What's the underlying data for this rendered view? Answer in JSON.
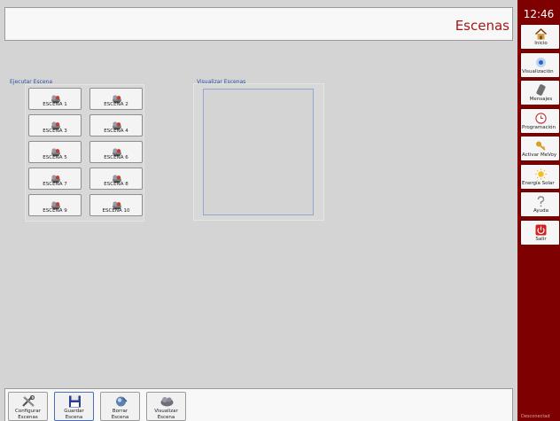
{
  "header": {
    "title": "Escenas"
  },
  "clock": "12:46",
  "ejecutar": {
    "title": "Ejecutar Escena",
    "scenes": [
      "ESCENA 1",
      "ESCENA 2",
      "ESCENA 3",
      "ESCENA 4",
      "ESCENA 5",
      "ESCENA 6",
      "ESCENA 7",
      "ESCENA 8",
      "ESCENA 9",
      "ESCENA 10"
    ]
  },
  "visualizar": {
    "title": "Visualizar Escenas"
  },
  "toolbar": {
    "items": [
      {
        "line1": "Configurar",
        "line2": "Escenas",
        "icon": "tools-icon"
      },
      {
        "line1": "Guardar",
        "line2": "Escena",
        "icon": "floppy-disk-icon"
      },
      {
        "line1": "Borrar",
        "line2": "Escena",
        "icon": "delete-scene-icon"
      },
      {
        "line1": "Visualizar",
        "line2": "Escena",
        "icon": "view-scene-icon"
      }
    ]
  },
  "sidebar": {
    "items": [
      {
        "label": "Inicio",
        "icon": "home-icon"
      },
      {
        "label": "Visualización",
        "icon": "eye-icon"
      },
      {
        "label": "Mensajes",
        "icon": "phone-icon"
      },
      {
        "label": "Programación",
        "icon": "clock-icon"
      },
      {
        "label": "Activar MeVoy",
        "icon": "key-icon"
      },
      {
        "label": "Energía Solar",
        "icon": "sun-icon"
      },
      {
        "label": "Ayuda",
        "icon": "help-icon"
      },
      {
        "label": "Salir",
        "icon": "power-icon"
      }
    ]
  },
  "status": {
    "text": "Desconectad"
  },
  "colors": {
    "accent": "#7e0000",
    "title": "#a31818",
    "section": "#2c4fa6"
  }
}
